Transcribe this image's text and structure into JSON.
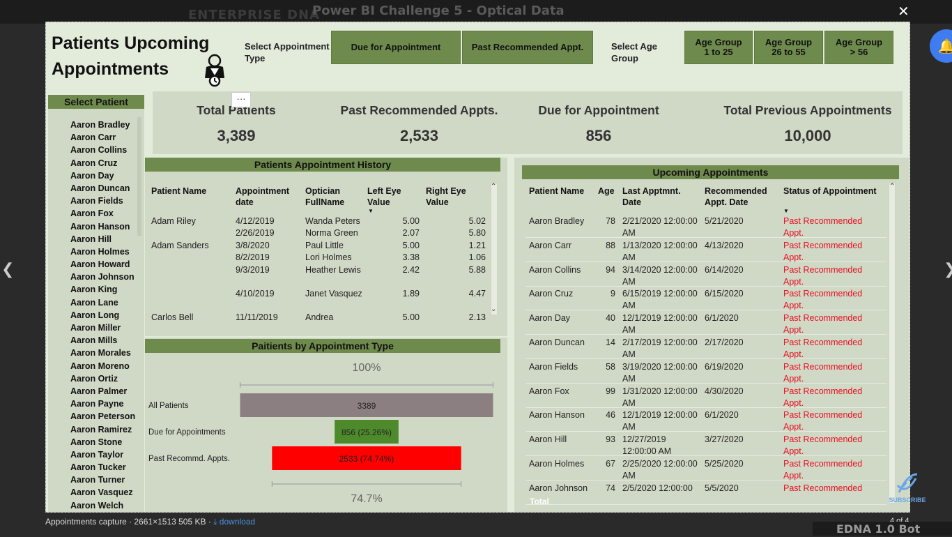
{
  "browser": {
    "brand": "ENTERPRISE DNA",
    "challenge_title": "Power BI Challenge 5 - Optical Data",
    "close": "✕",
    "bell": "🔔",
    "nav_prev": "❮",
    "nav_next": "❯"
  },
  "report": {
    "title": "Patients Upcoming Appointments",
    "appt_type_label": "Select Appointment Type",
    "appt_buttons": [
      "Due for Appointment",
      "Past Recommended Appt."
    ],
    "age_label": "Select Age Group",
    "age_buttons": [
      "Age Group 1 to 25",
      "Age Group 26 to 55",
      "Age Group > 56"
    ],
    "more_options": "···",
    "kpis": [
      {
        "label": "Total Patients",
        "value": "3,389"
      },
      {
        "label": "Past Recommended Appts.",
        "value": "2,533"
      },
      {
        "label": "Due for Appointment",
        "value": "856"
      },
      {
        "label": "Total Previous Appointments",
        "value": "10,000"
      }
    ],
    "patient_slicer": {
      "title": "Select Patient",
      "items": [
        "Aaron Bradley",
        "Aaron Carr",
        "Aaron Collins",
        "Aaron Cruz",
        "Aaron Day",
        "Aaron Duncan",
        "Aaron Fields",
        "Aaron Fox",
        "Aaron Hanson",
        "Aaron Hill",
        "Aaron Holmes",
        "Aaron Howard",
        "Aaron Johnson",
        "Aaron King",
        "Aaron Lane",
        "Aaron Long",
        "Aaron Miller",
        "Aaron Mills",
        "Aaron Morales",
        "Aaron Moreno",
        "Aaron Ortiz",
        "Aaron Palmer",
        "Aaron Payne",
        "Aaron Peterson",
        "Aaron Ramirez",
        "Aaron Stone",
        "Aaron Taylor",
        "Aaron Tucker",
        "Aaron Turner",
        "Aaron Vasquez",
        "Aaron Welch"
      ]
    },
    "history": {
      "title": "Patients Appointment History",
      "columns": [
        "Patient Name",
        "Appointment date",
        "Optician FullName",
        "Left Eye Value",
        "Right Eye Value"
      ],
      "rows": [
        {
          "patient": "Adam Riley",
          "date": "4/12/2019",
          "optician": "Wanda Peters",
          "left": "5.00",
          "right": "5.02"
        },
        {
          "patient": "",
          "date": "2/26/2019",
          "optician": "Norma Green",
          "left": "2.07",
          "right": "5.80"
        },
        {
          "patient": "Adam Sanders",
          "date": "3/8/2020",
          "optician": "Paul Little",
          "left": "5.00",
          "right": "1.21"
        },
        {
          "patient": "",
          "date": "8/2/2019",
          "optician": "Lori Holmes",
          "left": "3.38",
          "right": "1.06"
        },
        {
          "patient": "",
          "date": "9/3/2019",
          "optician": "Heather Lewis",
          "left": "2.42",
          "right": "5.88"
        },
        {
          "patient": "",
          "date": "4/10/2019",
          "optician": "Janet Vasquez",
          "left": "1.89",
          "right": "4.47"
        },
        {
          "patient": "Carlos Bell",
          "date": "11/11/2019",
          "optician": "Andrea",
          "left": "5.00",
          "right": "2.13"
        }
      ]
    },
    "funnel": {
      "title": "Paitients by Appointment Type",
      "top_pct": "100%",
      "bottom_pct": "74.7%",
      "stages": [
        {
          "label": "All Patients",
          "value": 3389,
          "text": "3389",
          "color": "#8c7f82"
        },
        {
          "label": "Due for Appointments",
          "value": 856,
          "text": "856 (25.26%)",
          "color": "#4e8a2b"
        },
        {
          "label": "Past Recommd. Appts.",
          "value": 2533,
          "text": "2533 (74.74%)",
          "color": "#ff0000"
        }
      ]
    },
    "upcoming": {
      "title": "Upcoming Appointments",
      "columns": [
        "Patient Name",
        "Age",
        "Last Apptmnt. Date",
        "Recommended Appt. Date",
        "Status of Appointment"
      ],
      "total_label": "Total",
      "rows": [
        {
          "patient": "Aaron Bradley",
          "age": "78",
          "last": "2/21/2020 12:00:00 AM",
          "rec": "5/21/2020",
          "status": "Past Recommended Appt."
        },
        {
          "patient": "Aaron Carr",
          "age": "88",
          "last": "1/13/2020 12:00:00 AM",
          "rec": "4/13/2020",
          "status": "Past Recommended Appt."
        },
        {
          "patient": "Aaron Collins",
          "age": "94",
          "last": "3/14/2020 12:00:00 AM",
          "rec": "6/14/2020",
          "status": "Past Recommended Appt."
        },
        {
          "patient": "Aaron Cruz",
          "age": "9",
          "last": "6/15/2019 12:00:00 AM",
          "rec": "6/15/2020",
          "status": "Past Recommended Appt."
        },
        {
          "patient": "Aaron Day",
          "age": "40",
          "last": "12/1/2019 12:00:00 AM",
          "rec": "6/1/2020",
          "status": "Past Recommended Appt."
        },
        {
          "patient": "Aaron Duncan",
          "age": "14",
          "last": "2/17/2019 12:00:00 AM",
          "rec": "2/17/2020",
          "status": "Past Recommended Appt."
        },
        {
          "patient": "Aaron Fields",
          "age": "58",
          "last": "3/19/2020 12:00:00 AM",
          "rec": "6/19/2020",
          "status": "Past Recommended Appt."
        },
        {
          "patient": "Aaron Fox",
          "age": "99",
          "last": "1/31/2020 12:00:00 AM",
          "rec": "4/30/2020",
          "status": "Past Recommended Appt."
        },
        {
          "patient": "Aaron Hanson",
          "age": "46",
          "last": "12/1/2019 12:00:00 AM",
          "rec": "6/1/2020",
          "status": "Past Recommended Appt."
        },
        {
          "patient": "Aaron Hill",
          "age": "93",
          "last": "12/27/2019 12:00:00 AM",
          "rec": "3/27/2020",
          "status": "Past Recommended Appt."
        },
        {
          "patient": "Aaron Holmes",
          "age": "67",
          "last": "2/25/2020 12:00:00 AM",
          "rec": "5/25/2020",
          "status": "Past Recommended Appt."
        },
        {
          "patient": "Aaron Johnson",
          "age": "74",
          "last": "2/5/2020 12:00:00",
          "rec": "5/5/2020",
          "status": "Past Recommended"
        }
      ]
    }
  },
  "viewer": {
    "caption": "Appointments capture · 2661×1513 505 KB ·",
    "download": "⤓ download",
    "count": "4 of 4",
    "bot": "EDNA 1.0 Bot",
    "subscribe": "SUBSCRIBE"
  },
  "colors": {
    "accent": "#6f8a4d",
    "panel": "#d0d8c6",
    "background": "#e3ebdb",
    "status_red": "#e81123"
  }
}
